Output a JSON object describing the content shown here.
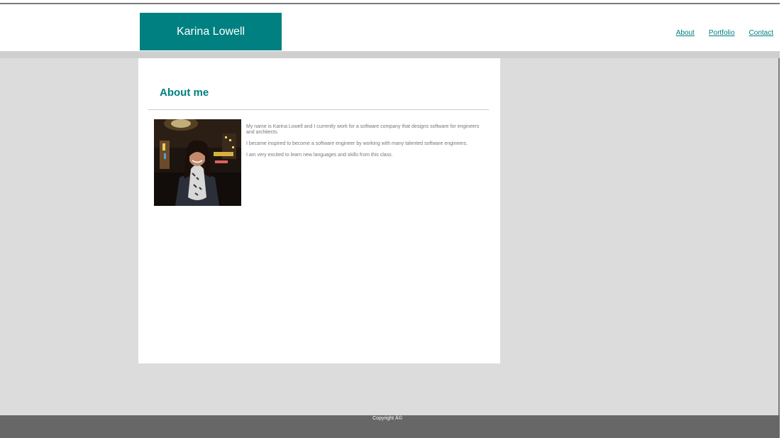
{
  "header": {
    "logo_text": "Karina Lowell",
    "nav": [
      {
        "label": "About"
      },
      {
        "label": "Portfolio"
      },
      {
        "label": "Contact"
      }
    ]
  },
  "main": {
    "heading": "About me",
    "photo_alt": "Karina Lowell portrait",
    "paragraphs": [
      "My name is Karina Lowell and I currently work for a software company that designs software for engineers and architects.",
      "I became inspired to become a software engineer by working with many talented software engineers.",
      "I am very excited to learn new languages and skills from this class."
    ]
  },
  "footer": {
    "copyright": "Copyright Â©"
  },
  "colors": {
    "accent": "#008080",
    "page_bg": "#dcdcdc",
    "footer_bg": "#676767"
  }
}
